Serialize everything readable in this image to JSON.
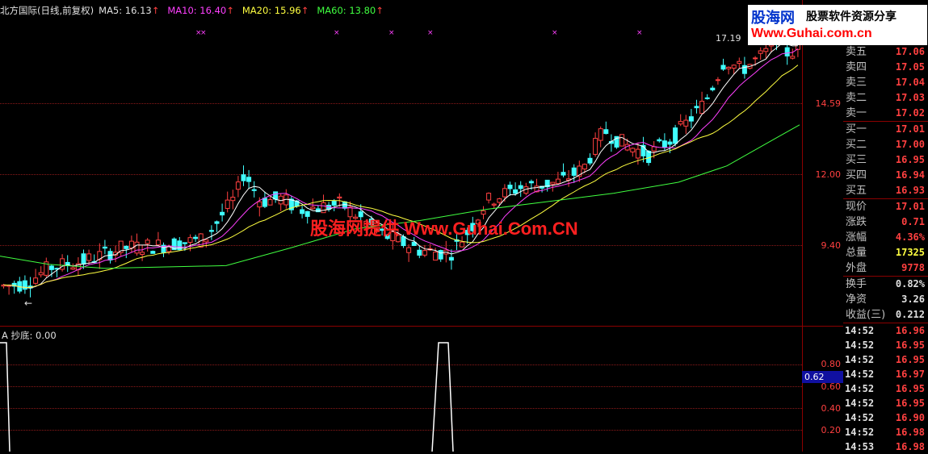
{
  "header": {
    "stock": "北方国际(日线,前复权)",
    "ma5": "MA5: 16.13",
    "ma10": "MA10: 16.40",
    "ma20": "MA20: 15.96",
    "ma60": "MA60: 13.80",
    "arrow": "↑"
  },
  "colors": {
    "ma5": "#ffffff",
    "ma10": "#ff40ff",
    "ma20": "#ffff40",
    "ma60": "#40ff40",
    "up": "#ff4040",
    "down": "#40ffff"
  },
  "price_axis": [
    "14.59",
    "12.00",
    "9.40"
  ],
  "high_marker": "17.19",
  "low_marker": "←",
  "indicator": {
    "title": "A 抄底: 0.00",
    "axis": [
      "0.80",
      "0.60",
      "0.40",
      "0.20"
    ],
    "cursor": "0.62"
  },
  "logo": {
    "brand": "股海网",
    "slogan": "股票软件资源分享",
    "url": "Www.Guhai.com.cn"
  },
  "watermark": "股海网提供 Www.Guhai.Com.CN",
  "quote": {
    "sell": [
      {
        "label": "卖五",
        "price": "17.06"
      },
      {
        "label": "卖四",
        "price": "17.05"
      },
      {
        "label": "卖三",
        "price": "17.04"
      },
      {
        "label": "卖二",
        "price": "17.03"
      },
      {
        "label": "卖一",
        "price": "17.02"
      }
    ],
    "buy": [
      {
        "label": "买一",
        "price": "17.01"
      },
      {
        "label": "买二",
        "price": "17.00"
      },
      {
        "label": "买三",
        "price": "16.95"
      },
      {
        "label": "买四",
        "price": "16.94"
      },
      {
        "label": "买五",
        "price": "16.93"
      }
    ],
    "stats1": [
      {
        "label": "现价",
        "value": "17.01",
        "color": "red"
      },
      {
        "label": "涨跌",
        "value": "0.71",
        "color": "red"
      },
      {
        "label": "涨幅",
        "value": "4.36%",
        "color": "red"
      },
      {
        "label": "总量",
        "value": "17325",
        "color": "yellow"
      },
      {
        "label": "外盘",
        "value": "9778",
        "color": "red"
      }
    ],
    "stats2": [
      {
        "label": "换手",
        "value": "0.82%",
        "color": "white"
      },
      {
        "label": "净资",
        "value": "3.26",
        "color": "white"
      },
      {
        "label": "收益(三)",
        "value": "0.212",
        "color": "white"
      }
    ],
    "ticks": [
      {
        "time": "14:52",
        "price": "16.96"
      },
      {
        "time": "14:52",
        "price": "16.95"
      },
      {
        "time": "14:52",
        "price": "16.95"
      },
      {
        "time": "14:52",
        "price": "16.97"
      },
      {
        "time": "14:52",
        "price": "16.95"
      },
      {
        "time": "14:52",
        "price": "16.95"
      },
      {
        "time": "14:52",
        "price": "16.90"
      },
      {
        "time": "14:52",
        "price": "16.98"
      },
      {
        "time": "14:53",
        "price": "16.98"
      }
    ]
  }
}
